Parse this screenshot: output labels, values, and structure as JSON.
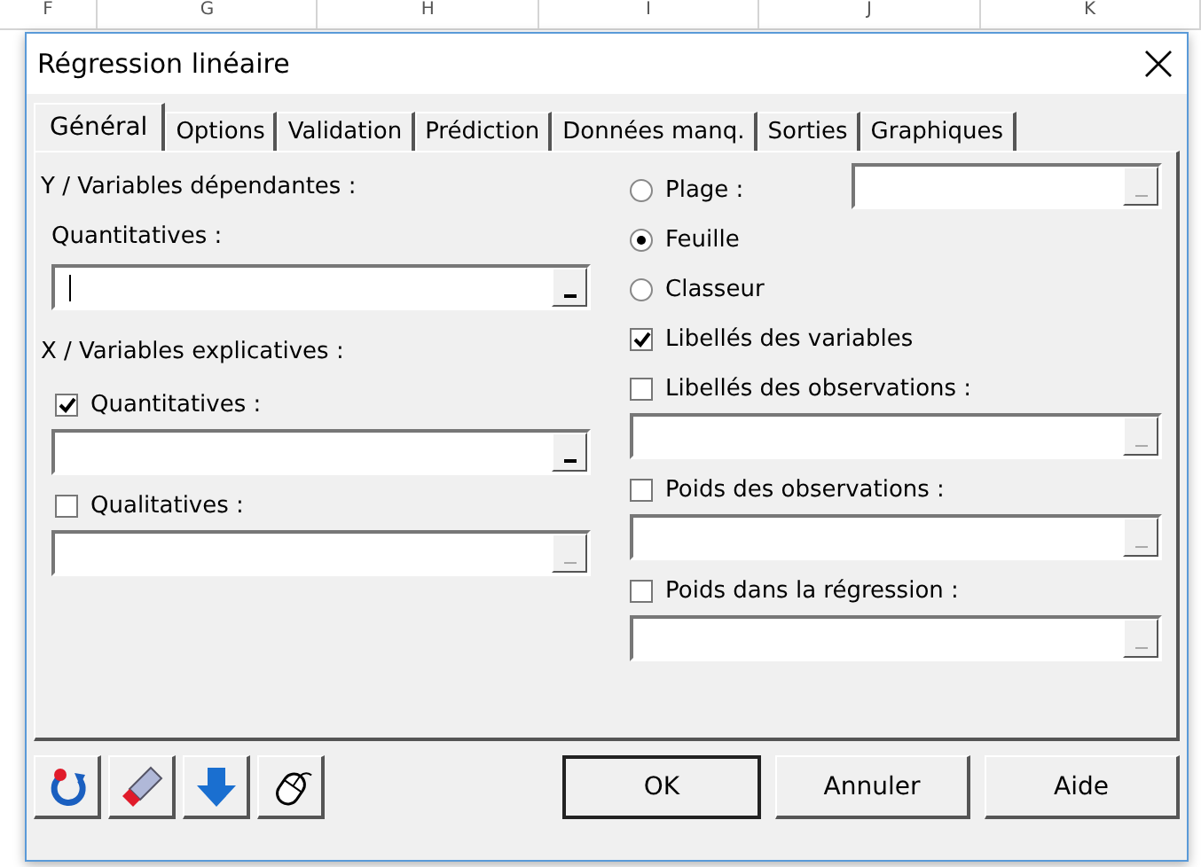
{
  "sheet_columns": [
    "F",
    "G",
    "H",
    "I",
    "J",
    "K"
  ],
  "window": {
    "title": "Régression linéaire"
  },
  "tabs": [
    {
      "label": "Général",
      "selected": true
    },
    {
      "label": "Options",
      "selected": false
    },
    {
      "label": "Validation",
      "selected": false
    },
    {
      "label": "Prédiction",
      "selected": false
    },
    {
      "label": "Données manq.",
      "selected": false
    },
    {
      "label": "Sorties",
      "selected": false
    },
    {
      "label": "Graphiques",
      "selected": false
    }
  ],
  "left_panel": [
    {
      "kind": "heading",
      "label": "Y / Variables dépendantes :"
    },
    {
      "kind": "label",
      "label": "Quantitatives :"
    },
    {
      "kind": "field",
      "enabled": true,
      "focused": true
    },
    {
      "kind": "heading",
      "label": "X / Variables explicatives :"
    },
    {
      "kind": "checkbox",
      "label": "Quantitatives :",
      "checked": true
    },
    {
      "kind": "field",
      "enabled": true
    },
    {
      "kind": "checkbox",
      "label": "Qualitatives :",
      "checked": false
    },
    {
      "kind": "field",
      "enabled": false
    }
  ],
  "right_panel": [
    {
      "kind": "radio",
      "label": "Plage :",
      "selected": false,
      "field": {
        "enabled": false
      }
    },
    {
      "kind": "radio",
      "label": "Feuille",
      "selected": true
    },
    {
      "kind": "radio",
      "label": "Classeur",
      "selected": false
    },
    {
      "kind": "checkbox",
      "label": "Libellés des variables",
      "checked": true
    },
    {
      "kind": "checkbox",
      "label": "Libellés des observations :",
      "checked": false
    },
    {
      "kind": "field",
      "enabled": false
    },
    {
      "kind": "checkbox",
      "label": "Poids des observations :",
      "checked": false
    },
    {
      "kind": "field",
      "enabled": false
    },
    {
      "kind": "checkbox",
      "label": "Poids dans la régression :",
      "checked": false
    },
    {
      "kind": "field",
      "enabled": false
    }
  ],
  "toolbar": [
    {
      "kind": "reset"
    },
    {
      "kind": "eraser"
    },
    {
      "kind": "down"
    },
    {
      "kind": "mouse"
    }
  ],
  "buttons": [
    {
      "label": "OK",
      "default": true
    },
    {
      "label": "Annuler",
      "default": false
    },
    {
      "label": "Aide",
      "default": false
    }
  ]
}
